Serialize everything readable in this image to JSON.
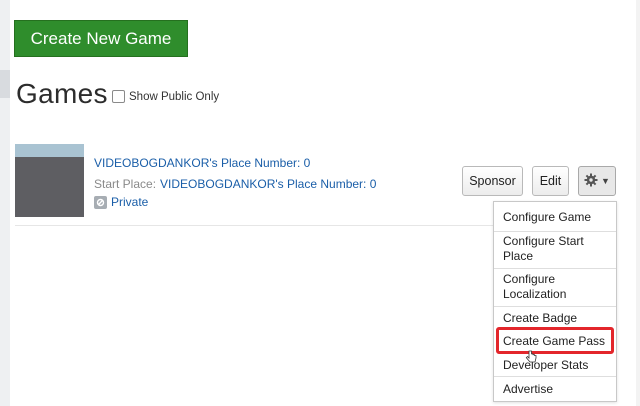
{
  "toolbar": {
    "create_label": "Create New Game"
  },
  "header": {
    "title": "Games",
    "show_public_label": "Show Public Only"
  },
  "game": {
    "place_name": "VIDEOBOGDANKOR's Place Number: 0",
    "start_place_label": "Start Place:",
    "start_place_value": "VIDEOBOGDANKOR's Place Number: 0",
    "privacy": "Private"
  },
  "actions": {
    "sponsor_label": "Sponsor",
    "edit_label": "Edit",
    "gear_icon": "gear-icon",
    "caret": "▼"
  },
  "menu": {
    "configure_game": "Configure Game",
    "configure_start_place_1": "Configure Start",
    "configure_start_place_2": "Place",
    "configure_localization_1": "Configure",
    "configure_localization_2": "Localization",
    "create_badge": "Create Badge",
    "create_game_pass": "Create Game Pass",
    "developer_stats": "Developer Stats",
    "advertise": "Advertise"
  },
  "colors": {
    "create_button": "#2f8d2c",
    "link": "#1a5ea8",
    "highlight": "#e3262b"
  }
}
